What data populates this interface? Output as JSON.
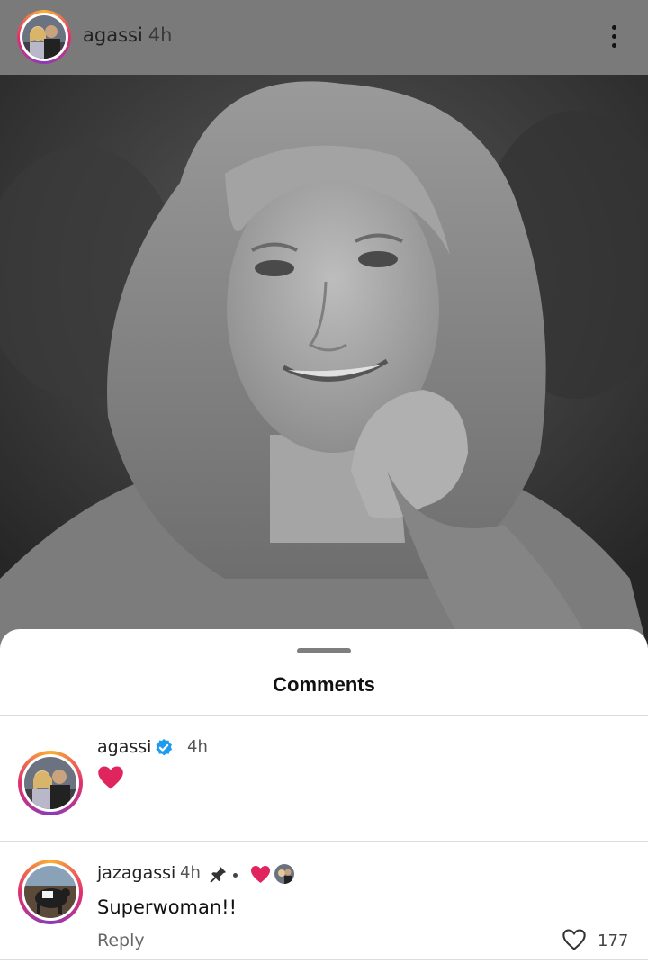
{
  "post": {
    "username": "agassi",
    "time": "4h",
    "menu_icon": "more-vertical-icon"
  },
  "sheet": {
    "title": "Comments"
  },
  "comments": [
    {
      "username": "agassi",
      "verified": true,
      "time": "4h",
      "text": "❤️"
    },
    {
      "username": "jazagassi",
      "time": "4h",
      "pinned": true,
      "liked_by_author": true,
      "text": "Superwoman!!",
      "reply_label": "Reply",
      "like_count": "177"
    }
  ],
  "colors": {
    "header_bg": "#7a7a7a",
    "verified_blue": "#1d9bf0",
    "heart_red": "#e0245e",
    "story_ring": [
      "#f9b233",
      "#e1306c",
      "#8a3ab9"
    ]
  }
}
